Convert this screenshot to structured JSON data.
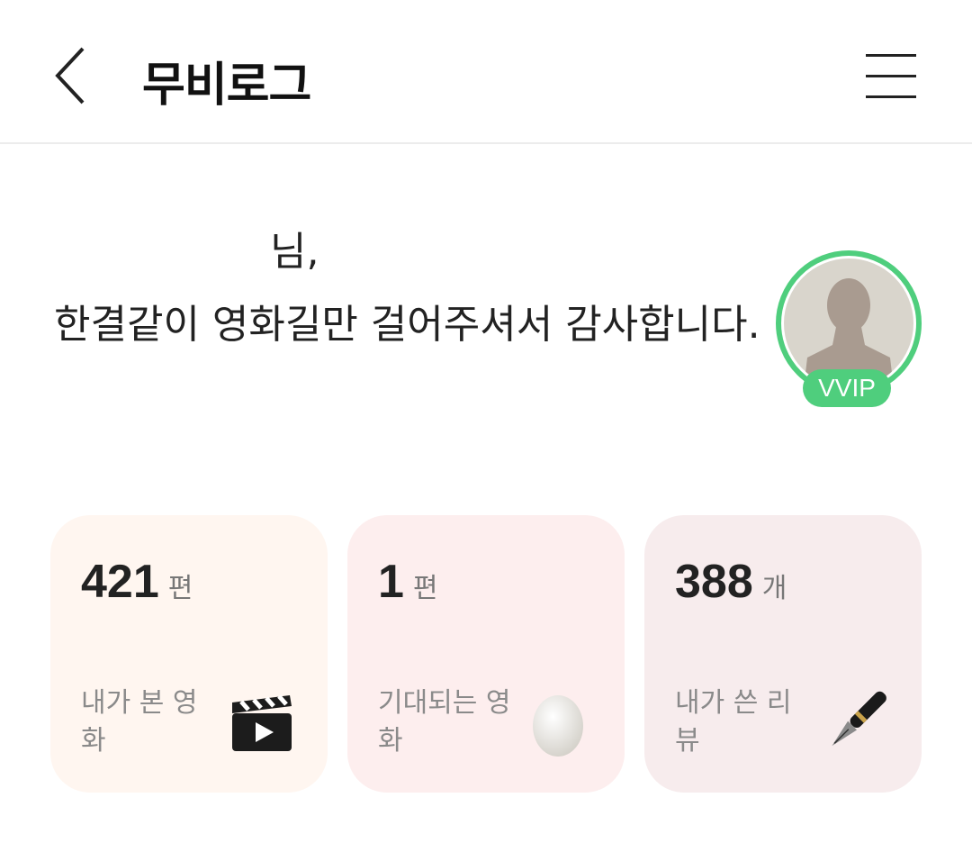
{
  "header": {
    "title": "무비로그"
  },
  "greeting": {
    "name_suffix": "님,",
    "message": "한결같이 영화길만 걸어주셔서 감사합니다."
  },
  "profile": {
    "badge": "VVIP",
    "accent": "#4fce7d"
  },
  "stats": [
    {
      "count": "421",
      "unit": "편",
      "label": "내가 본 영화",
      "icon": "clapperboard-icon",
      "bg": "#fff6f0"
    },
    {
      "count": "1",
      "unit": "편",
      "label": "기대되는 영화",
      "icon": "egg-icon",
      "bg": "#fdeeee"
    },
    {
      "count": "388",
      "unit": "개",
      "label": "내가 쓴 리뷰",
      "icon": "fountain-pen-icon",
      "bg": "#f7eced"
    }
  ]
}
